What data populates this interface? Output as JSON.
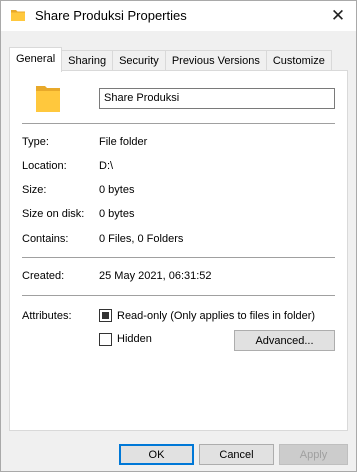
{
  "window": {
    "title": "Share Produksi Properties",
    "close_glyph": "✕"
  },
  "tabs": [
    {
      "label": "General",
      "active": true
    },
    {
      "label": "Sharing",
      "active": false
    },
    {
      "label": "Security",
      "active": false
    },
    {
      "label": "Previous Versions",
      "active": false
    },
    {
      "label": "Customize",
      "active": false
    }
  ],
  "general": {
    "folder_name": "Share Produksi",
    "properties": [
      {
        "label": "Type:",
        "value": "File folder"
      },
      {
        "label": "Location:",
        "value": "D:\\"
      },
      {
        "label": "Size:",
        "value": "0 bytes"
      },
      {
        "label": "Size on disk:",
        "value": "0 bytes"
      },
      {
        "label": "Contains:",
        "value": "0 Files, 0 Folders"
      }
    ],
    "created": {
      "label": "Created:",
      "value": "25 May 2021, 06:31:52"
    },
    "attributes": {
      "label": "Attributes:",
      "readonly_label": "Read-only (Only applies to files in folder)",
      "hidden_label": "Hidden",
      "advanced_label": "Advanced..."
    }
  },
  "buttons": {
    "ok": "OK",
    "cancel": "Cancel",
    "apply": "Apply"
  },
  "colors": {
    "folder_yellow": "#ffc83d",
    "folder_dark": "#e8a92a",
    "accent_blue": "#0078d7"
  },
  "icons": {
    "title_icon": "folder-icon",
    "close_icon": "close-icon",
    "main_icon": "folder-icon"
  }
}
